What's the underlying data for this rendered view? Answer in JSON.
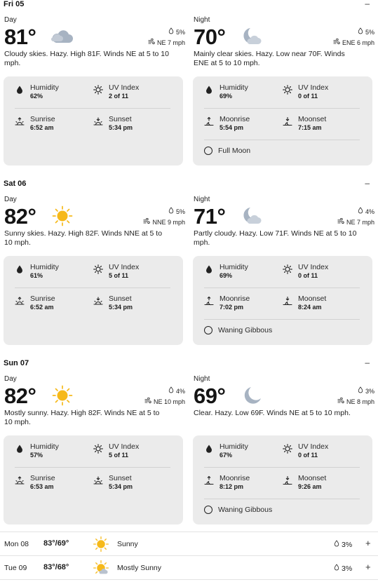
{
  "days": [
    {
      "header": "Fri 05",
      "toggle": "–",
      "day": {
        "label": "Day",
        "temp": "81°",
        "icon": "cloudy-icon",
        "precip": "5%",
        "wind": "NE 7 mph",
        "desc": "Cloudy skies. Hazy. High 81F. Winds NE at 5 to 10 mph.",
        "humidity_label": "Humidity",
        "humidity": "62%",
        "uv_label": "UV Index",
        "uv": "2 of 11",
        "rise_label": "Sunrise",
        "rise": "6:52 am",
        "set_label": "Sunset",
        "set": "5:34 pm"
      },
      "night": {
        "label": "Night",
        "temp": "70°",
        "icon": "moon-cloud-icon",
        "precip": "5%",
        "wind": "ENE 6 mph",
        "desc": "Mainly clear skies. Hazy. Low near 70F. Winds ENE at 5 to 10 mph.",
        "humidity_label": "Humidity",
        "humidity": "69%",
        "uv_label": "UV Index",
        "uv": "0 of 11",
        "rise_label": "Moonrise",
        "rise": "5:54 pm",
        "set_label": "Moonset",
        "set": "7:15 am",
        "moon_phase": "Full Moon"
      }
    },
    {
      "header": "Sat 06",
      "toggle": "–",
      "day": {
        "label": "Day",
        "temp": "82°",
        "icon": "sun-icon",
        "precip": "5%",
        "wind": "NNE 9 mph",
        "desc": "Sunny skies. Hazy. High 82F. Winds NNE at 5 to 10 mph.",
        "humidity_label": "Humidity",
        "humidity": "61%",
        "uv_label": "UV Index",
        "uv": "5 of 11",
        "rise_label": "Sunrise",
        "rise": "6:52 am",
        "set_label": "Sunset",
        "set": "5:34 pm"
      },
      "night": {
        "label": "Night",
        "temp": "71°",
        "icon": "moon-cloud-icon",
        "precip": "4%",
        "wind": "NE 7 mph",
        "desc": "Partly cloudy. Hazy. Low 71F. Winds NE at 5 to 10 mph.",
        "humidity_label": "Humidity",
        "humidity": "69%",
        "uv_label": "UV Index",
        "uv": "0 of 11",
        "rise_label": "Moonrise",
        "rise": "7:02 pm",
        "set_label": "Moonset",
        "set": "8:24 am",
        "moon_phase": "Waning Gibbous"
      }
    },
    {
      "header": "Sun 07",
      "toggle": "–",
      "day": {
        "label": "Day",
        "temp": "82°",
        "icon": "sun-icon",
        "precip": "4%",
        "wind": "NE 10 mph",
        "desc": "Mostly sunny. Hazy. High 82F. Winds NE at 5 to 10 mph.",
        "humidity_label": "Humidity",
        "humidity": "57%",
        "uv_label": "UV Index",
        "uv": "5 of 11",
        "rise_label": "Sunrise",
        "rise": "6:53 am",
        "set_label": "Sunset",
        "set": "5:34 pm"
      },
      "night": {
        "label": "Night",
        "temp": "69°",
        "icon": "moon-icon",
        "precip": "3%",
        "wind": "NE 8 mph",
        "desc": "Clear. Hazy. Low 69F. Winds NE at 5 to 10 mph.",
        "humidity_label": "Humidity",
        "humidity": "67%",
        "uv_label": "UV Index",
        "uv": "0 of 11",
        "rise_label": "Moonrise",
        "rise": "8:12 pm",
        "set_label": "Moonset",
        "set": "9:26 am",
        "moon_phase": "Waning Gibbous"
      }
    }
  ],
  "forecast": [
    {
      "date": "Mon 08",
      "temps": "83°/69°",
      "icon": "sun-icon",
      "condition": "Sunny",
      "precip": "3%",
      "expand": "+"
    },
    {
      "date": "Tue 09",
      "temps": "83°/68°",
      "icon": "partly-sunny-icon",
      "condition": "Mostly Sunny",
      "precip": "3%",
      "expand": "+"
    }
  ],
  "colors": {
    "sun": "#f6b91a",
    "cloud": "#a7b3c2",
    "card": "#ebebeb",
    "text": "#1b1b1b"
  }
}
